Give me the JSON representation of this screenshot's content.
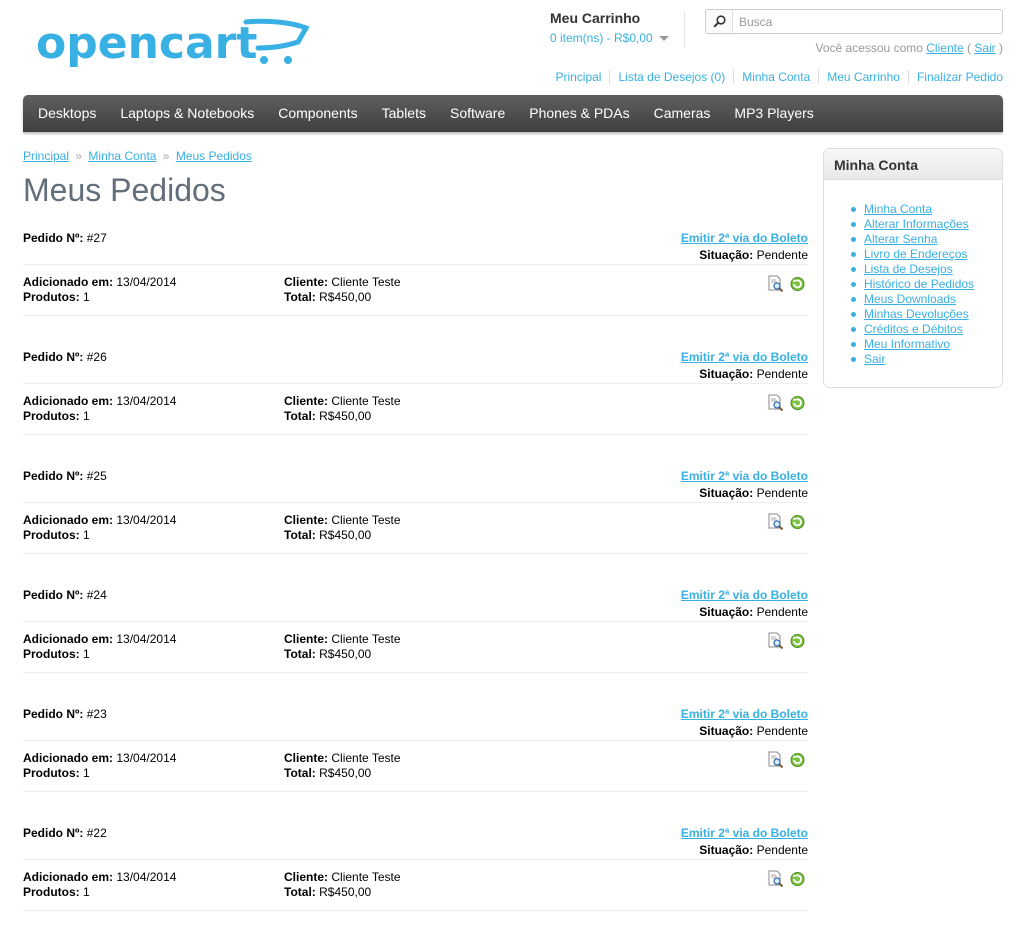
{
  "logo": {
    "text": "opencart",
    "colors": {
      "logo": "#38b0e3"
    }
  },
  "cart": {
    "title": "Meu Carrinho",
    "total": "0 item(ns) - R$0,00"
  },
  "search": {
    "placeholder": "Busca",
    "icon": "search-icon"
  },
  "welcome": {
    "prefix": "Você acessou como",
    "user": "Cliente",
    "open_paren": "(",
    "logout": "Sair",
    "close_paren": ")"
  },
  "top_links": [
    "Principal",
    "Lista de Desejos (0)",
    "Minha Conta",
    "Meu Carrinho",
    "Finalizar Pedido"
  ],
  "menu": [
    "Desktops",
    "Laptops & Notebooks",
    "Components",
    "Tablets",
    "Software",
    "Phones & PDAs",
    "Cameras",
    "MP3 Players"
  ],
  "breadcrumb": {
    "items": [
      "Principal",
      "Minha Conta",
      "Meus Pedidos"
    ],
    "separator": "»"
  },
  "page_title": "Meus Pedidos",
  "labels": {
    "order_id": "Pedido Nº:",
    "boleto": "Emitir 2ª via do Boleto",
    "status": "Situação:",
    "added": "Adicionado em:",
    "products": "Produtos:",
    "customer": "Cliente:",
    "total": "Total:"
  },
  "orders": [
    {
      "id": "#27",
      "status": "Pendente",
      "date": "13/04/2014",
      "products": "1",
      "customer": "Cliente Teste",
      "total": "R$450,00"
    },
    {
      "id": "#26",
      "status": "Pendente",
      "date": "13/04/2014",
      "products": "1",
      "customer": "Cliente Teste",
      "total": "R$450,00"
    },
    {
      "id": "#25",
      "status": "Pendente",
      "date": "13/04/2014",
      "products": "1",
      "customer": "Cliente Teste",
      "total": "R$450,00"
    },
    {
      "id": "#24",
      "status": "Pendente",
      "date": "13/04/2014",
      "products": "1",
      "customer": "Cliente Teste",
      "total": "R$450,00"
    },
    {
      "id": "#23",
      "status": "Pendente",
      "date": "13/04/2014",
      "products": "1",
      "customer": "Cliente Teste",
      "total": "R$450,00"
    },
    {
      "id": "#22",
      "status": "Pendente",
      "date": "13/04/2014",
      "products": "1",
      "customer": "Cliente Teste",
      "total": "R$450,00"
    }
  ],
  "order_icons": [
    "view-order-icon",
    "reorder-icon"
  ],
  "sidebar": {
    "heading": "Minha Conta",
    "items": [
      "Minha Conta",
      "Alterar Informações",
      "Alterar Senha",
      "Livro de Endereços",
      "Lista de Desejos",
      "Histórico de Pedidos",
      "Meus Downloads",
      "Minhas Devoluções",
      "Créditos e Débitos",
      "Meu Informativo",
      "Sair"
    ]
  },
  "colors": {
    "link": "#38b0e3",
    "menu_bg": "#4a4a4a",
    "title": "#636e7b"
  }
}
